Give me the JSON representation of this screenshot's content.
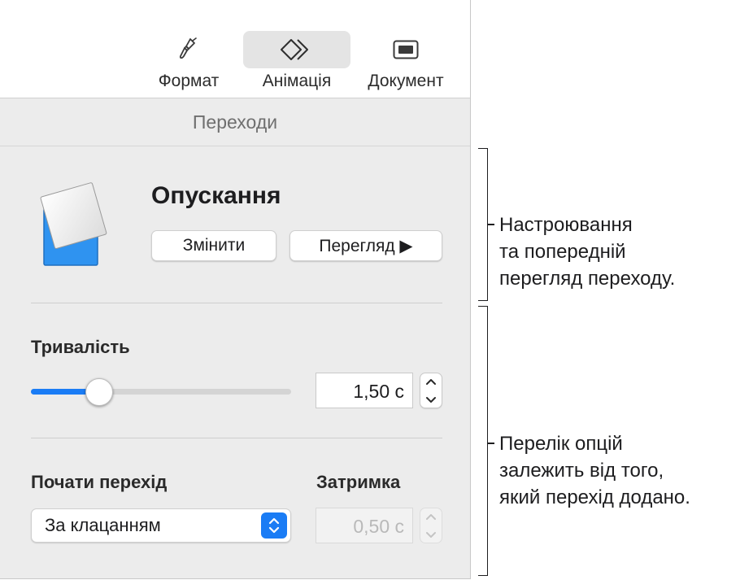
{
  "toolbar": {
    "tabs": [
      {
        "label": "Формат",
        "icon": "paintbrush-icon",
        "active": false
      },
      {
        "label": "Анімація",
        "icon": "animation-diamond-icon",
        "active": true
      },
      {
        "label": "Документ",
        "icon": "document-icon",
        "active": false
      }
    ]
  },
  "section_title": "Переходи",
  "transition": {
    "name": "Опускання",
    "thumbnail_icon": "drop-transition-icon",
    "change_label": "Змінити",
    "preview_label": "Перегляд ▶"
  },
  "duration": {
    "label": "Тривалість",
    "value": "1,50 с",
    "slider_level_percent": 26
  },
  "start": {
    "label": "Почати перехід",
    "selected": "За клацанням"
  },
  "delay": {
    "label": "Затримка",
    "value": "0,50 с",
    "disabled": true
  },
  "callouts": {
    "top": [
      "Настроювання",
      "та попередній",
      "перегляд переходу."
    ],
    "bottom": [
      "Перелік опцій",
      "залежить від того,",
      "який перехід додано."
    ]
  },
  "colors": {
    "accent": "#1a7cf5",
    "panel_bg": "#ececec",
    "thumbnail_blue": "#2f93f0"
  }
}
